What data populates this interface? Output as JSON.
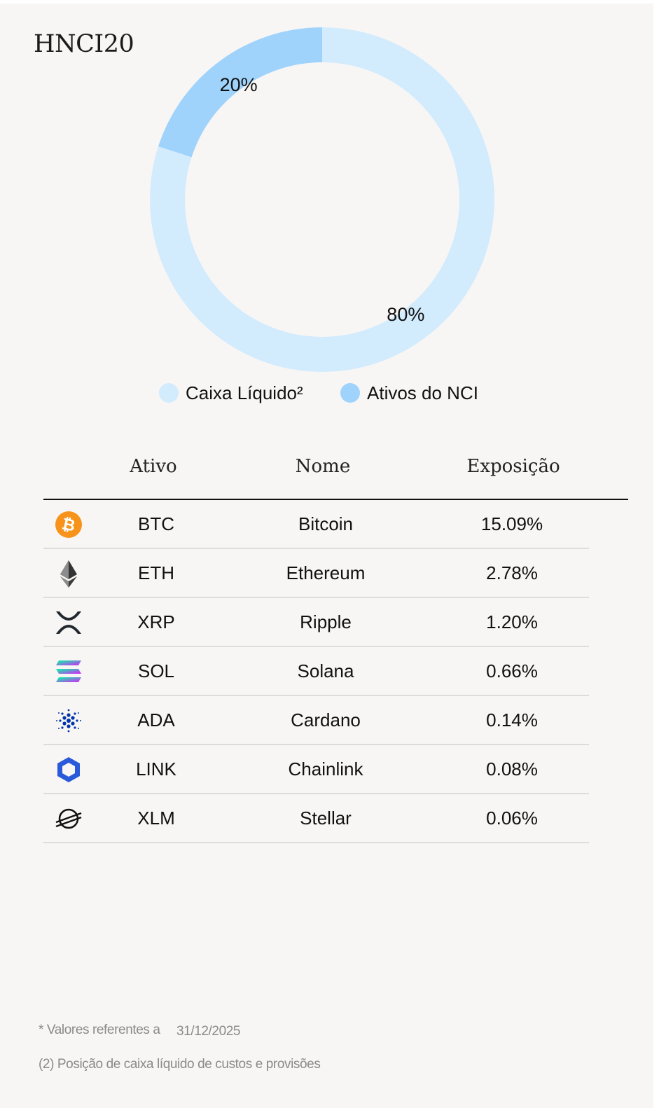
{
  "title": "HNCI20",
  "chart_data": {
    "type": "pie",
    "donut": true,
    "slices": [
      {
        "name": "Caixa Líquido²",
        "value": 80,
        "label": "80%",
        "color": "#d2ebfd"
      },
      {
        "name": "Ativos do NCI",
        "value": 20,
        "label": "20%",
        "color": "#9fd3fb"
      }
    ],
    "legend_position": "bottom"
  },
  "table": {
    "headers": {
      "asset": "Ativo",
      "name": "Nome",
      "exposure": "Exposição"
    },
    "rows": [
      {
        "icon": "bitcoin-icon",
        "asset": "BTC",
        "name": "Bitcoin",
        "exposure": "15.09%"
      },
      {
        "icon": "ethereum-icon",
        "asset": "ETH",
        "name": "Ethereum",
        "exposure": "2.78%"
      },
      {
        "icon": "xrp-icon",
        "asset": "XRP",
        "name": "Ripple",
        "exposure": "1.20%"
      },
      {
        "icon": "solana-icon",
        "asset": "SOL",
        "name": "Solana",
        "exposure": "0.66%"
      },
      {
        "icon": "cardano-icon",
        "asset": "ADA",
        "name": "Cardano",
        "exposure": "0.14%"
      },
      {
        "icon": "chainlink-icon",
        "asset": "LINK",
        "name": "Chainlink",
        "exposure": "0.08%"
      },
      {
        "icon": "stellar-icon",
        "asset": "XLM",
        "name": "Stellar",
        "exposure": "0.06%"
      }
    ]
  },
  "footnotes": {
    "values_ref": "* Valores referentes a",
    "date": "31/12/2025",
    "note2": "(2) Posição de caixa líquido de custos e provisões"
  },
  "colors": {
    "background": "#f7f6f5",
    "bitcoin": "#f7931a",
    "chainlink": "#2a5ada"
  }
}
